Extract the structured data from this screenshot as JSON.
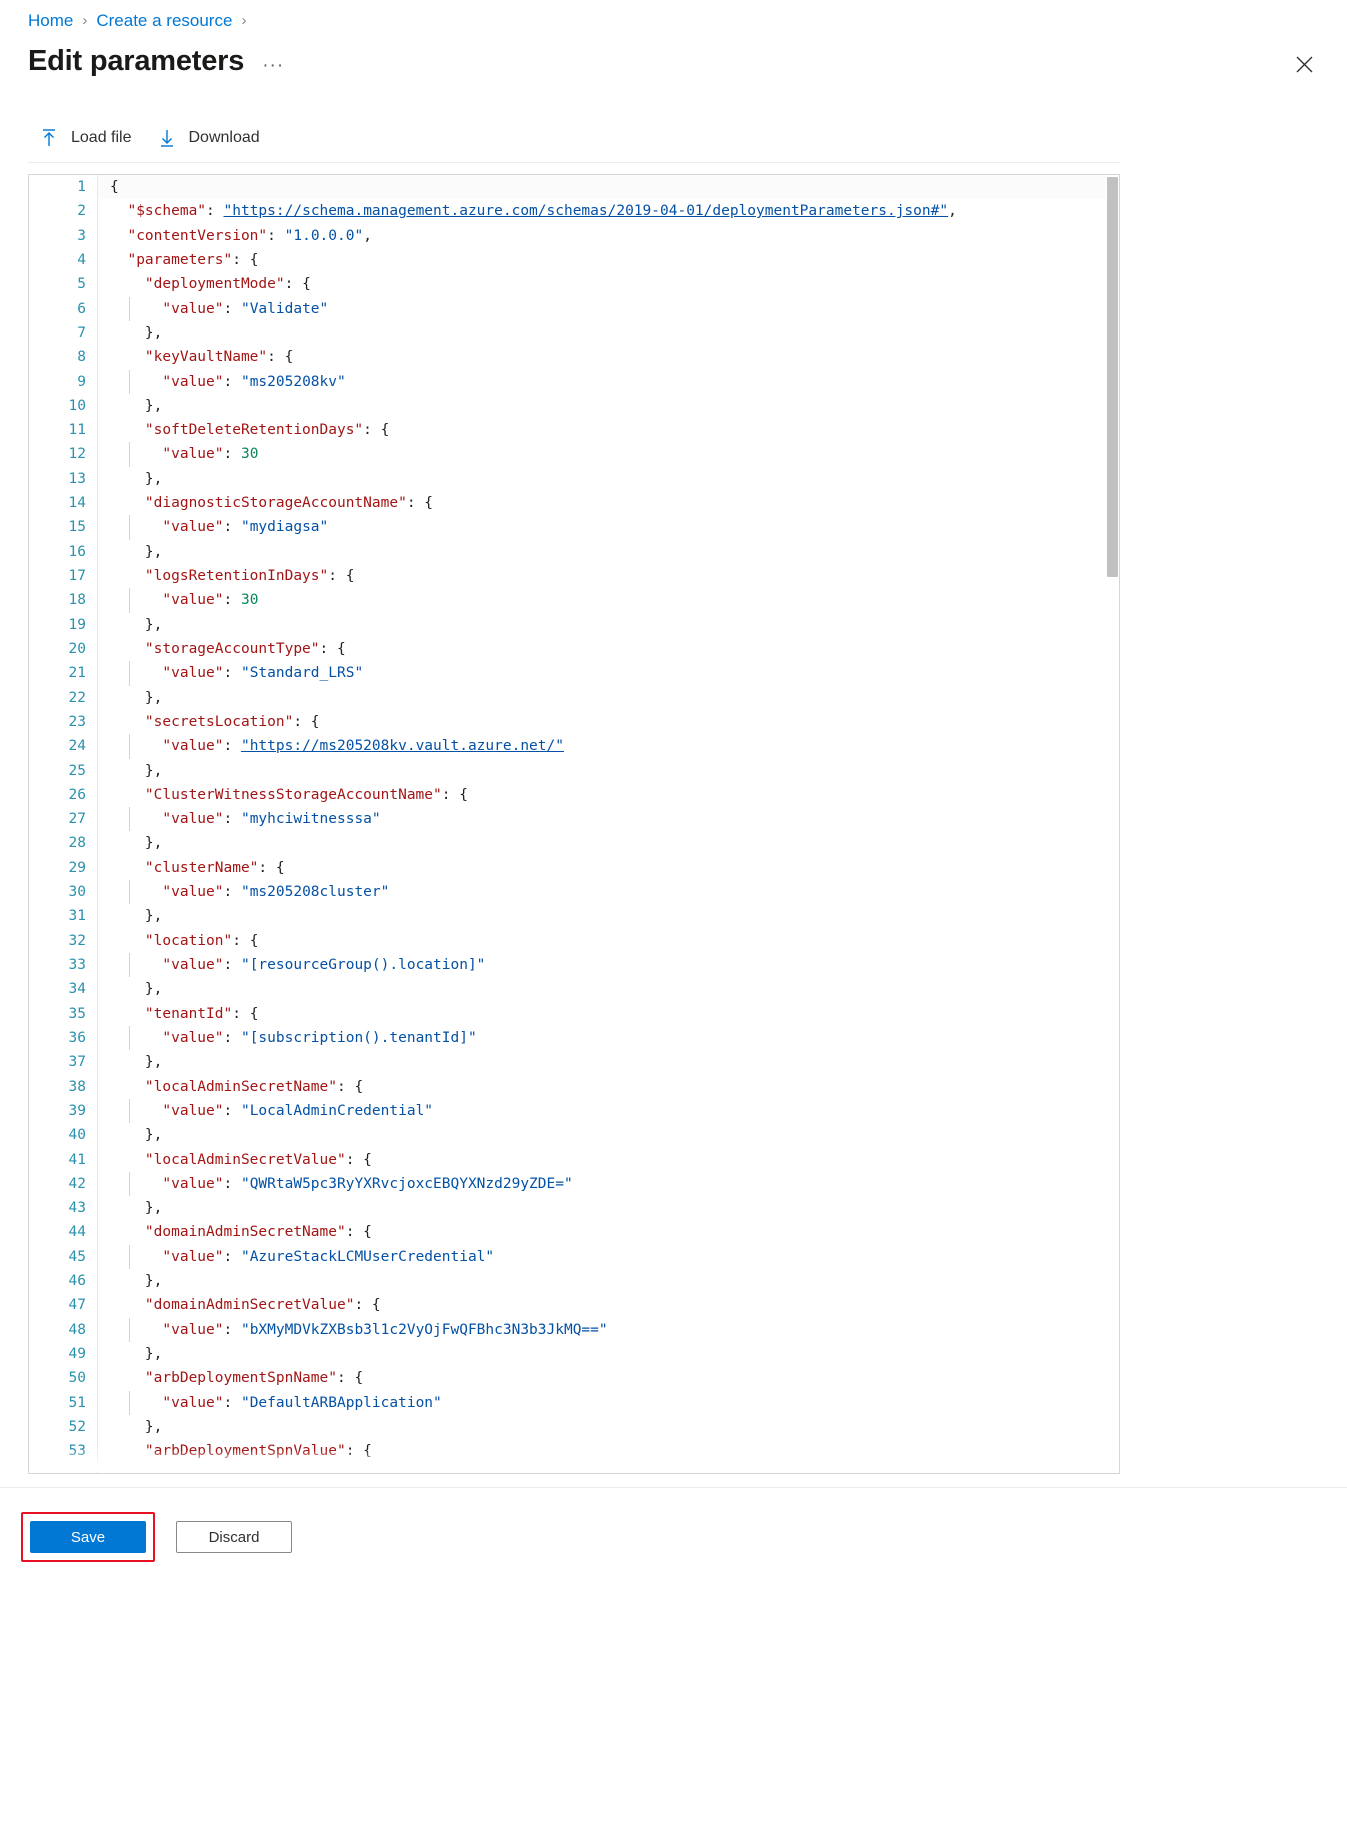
{
  "breadcrumb": {
    "items": [
      {
        "label": "Home",
        "link": true
      },
      {
        "label": "Create a resource",
        "link": true
      }
    ],
    "separator": "›"
  },
  "header": {
    "title": "Edit parameters",
    "ellipsis": "···",
    "close_label": "Close"
  },
  "toolbar": {
    "load_file_label": "Load file",
    "download_label": "Download",
    "load_file_icon": "upload-arrow-icon",
    "download_icon": "download-arrow-icon"
  },
  "editor": {
    "line_numbers": [
      1,
      2,
      3,
      4,
      5,
      6,
      7,
      8,
      9,
      10,
      11,
      12,
      13,
      14,
      15,
      16,
      17,
      18,
      19,
      20,
      21,
      22,
      23,
      24,
      25,
      26,
      27,
      28,
      29,
      30,
      31,
      32,
      33,
      34,
      35,
      36,
      37,
      38,
      39,
      40,
      41,
      42,
      43,
      44,
      45,
      46,
      47,
      48,
      49,
      50,
      51,
      52,
      53
    ],
    "colors": {
      "key": "#a31515",
      "string": "#0451a5",
      "number": "#098658",
      "punctuation": "#1f1f1f",
      "line_number": "#2b91af"
    },
    "lines": [
      {
        "n": 1,
        "indent": 0,
        "parts": [
          {
            "t": "{",
            "c": "p"
          }
        ]
      },
      {
        "n": 2,
        "indent": 1,
        "parts": [
          {
            "t": "\"$schema\"",
            "c": "k"
          },
          {
            "t": ": ",
            "c": "p"
          },
          {
            "t": "\"https://schema.management.azure.com/schemas/2019-04-01/deploymentParameters.json#\"",
            "c": "lk"
          },
          {
            "t": ",",
            "c": "p"
          }
        ]
      },
      {
        "n": 3,
        "indent": 1,
        "parts": [
          {
            "t": "\"contentVersion\"",
            "c": "k"
          },
          {
            "t": ": ",
            "c": "p"
          },
          {
            "t": "\"1.0.0.0\"",
            "c": "s"
          },
          {
            "t": ",",
            "c": "p"
          }
        ]
      },
      {
        "n": 4,
        "indent": 1,
        "parts": [
          {
            "t": "\"parameters\"",
            "c": "k"
          },
          {
            "t": ": {",
            "c": "p"
          }
        ]
      },
      {
        "n": 5,
        "indent": 2,
        "parts": [
          {
            "t": "\"deploymentMode\"",
            "c": "k"
          },
          {
            "t": ": {",
            "c": "p"
          }
        ]
      },
      {
        "n": 6,
        "indent": 3,
        "parts": [
          {
            "t": "\"value\"",
            "c": "k"
          },
          {
            "t": ": ",
            "c": "p"
          },
          {
            "t": "\"Validate\"",
            "c": "s"
          }
        ]
      },
      {
        "n": 7,
        "indent": 2,
        "parts": [
          {
            "t": "},",
            "c": "p"
          }
        ]
      },
      {
        "n": 8,
        "indent": 2,
        "parts": [
          {
            "t": "\"keyVaultName\"",
            "c": "k"
          },
          {
            "t": ": {",
            "c": "p"
          }
        ]
      },
      {
        "n": 9,
        "indent": 3,
        "parts": [
          {
            "t": "\"value\"",
            "c": "k"
          },
          {
            "t": ": ",
            "c": "p"
          },
          {
            "t": "\"ms205208kv\"",
            "c": "s"
          }
        ]
      },
      {
        "n": 10,
        "indent": 2,
        "parts": [
          {
            "t": "},",
            "c": "p"
          }
        ]
      },
      {
        "n": 11,
        "indent": 2,
        "parts": [
          {
            "t": "\"softDeleteRetentionDays\"",
            "c": "k"
          },
          {
            "t": ": {",
            "c": "p"
          }
        ]
      },
      {
        "n": 12,
        "indent": 3,
        "parts": [
          {
            "t": "\"value\"",
            "c": "k"
          },
          {
            "t": ": ",
            "c": "p"
          },
          {
            "t": "30",
            "c": "n"
          }
        ]
      },
      {
        "n": 13,
        "indent": 2,
        "parts": [
          {
            "t": "},",
            "c": "p"
          }
        ]
      },
      {
        "n": 14,
        "indent": 2,
        "parts": [
          {
            "t": "\"diagnosticStorageAccountName\"",
            "c": "k"
          },
          {
            "t": ": {",
            "c": "p"
          }
        ]
      },
      {
        "n": 15,
        "indent": 3,
        "parts": [
          {
            "t": "\"value\"",
            "c": "k"
          },
          {
            "t": ": ",
            "c": "p"
          },
          {
            "t": "\"mydiagsa\"",
            "c": "s"
          }
        ]
      },
      {
        "n": 16,
        "indent": 2,
        "parts": [
          {
            "t": "},",
            "c": "p"
          }
        ]
      },
      {
        "n": 17,
        "indent": 2,
        "parts": [
          {
            "t": "\"logsRetentionInDays\"",
            "c": "k"
          },
          {
            "t": ": {",
            "c": "p"
          }
        ]
      },
      {
        "n": 18,
        "indent": 3,
        "parts": [
          {
            "t": "\"value\"",
            "c": "k"
          },
          {
            "t": ": ",
            "c": "p"
          },
          {
            "t": "30",
            "c": "n"
          }
        ]
      },
      {
        "n": 19,
        "indent": 2,
        "parts": [
          {
            "t": "},",
            "c": "p"
          }
        ]
      },
      {
        "n": 20,
        "indent": 2,
        "parts": [
          {
            "t": "\"storageAccountType\"",
            "c": "k"
          },
          {
            "t": ": {",
            "c": "p"
          }
        ]
      },
      {
        "n": 21,
        "indent": 3,
        "parts": [
          {
            "t": "\"value\"",
            "c": "k"
          },
          {
            "t": ": ",
            "c": "p"
          },
          {
            "t": "\"Standard_LRS\"",
            "c": "s"
          }
        ]
      },
      {
        "n": 22,
        "indent": 2,
        "parts": [
          {
            "t": "},",
            "c": "p"
          }
        ]
      },
      {
        "n": 23,
        "indent": 2,
        "parts": [
          {
            "t": "\"secretsLocation\"",
            "c": "k"
          },
          {
            "t": ": {",
            "c": "p"
          }
        ]
      },
      {
        "n": 24,
        "indent": 3,
        "parts": [
          {
            "t": "\"value\"",
            "c": "k"
          },
          {
            "t": ": ",
            "c": "p"
          },
          {
            "t": "\"https://ms205208kv.vault.azure.net/\"",
            "c": "lk"
          }
        ]
      },
      {
        "n": 25,
        "indent": 2,
        "parts": [
          {
            "t": "},",
            "c": "p"
          }
        ]
      },
      {
        "n": 26,
        "indent": 2,
        "parts": [
          {
            "t": "\"ClusterWitnessStorageAccountName\"",
            "c": "k"
          },
          {
            "t": ": {",
            "c": "p"
          }
        ]
      },
      {
        "n": 27,
        "indent": 3,
        "parts": [
          {
            "t": "\"value\"",
            "c": "k"
          },
          {
            "t": ": ",
            "c": "p"
          },
          {
            "t": "\"myhciwitnesssa\"",
            "c": "s"
          }
        ]
      },
      {
        "n": 28,
        "indent": 2,
        "parts": [
          {
            "t": "},",
            "c": "p"
          }
        ]
      },
      {
        "n": 29,
        "indent": 2,
        "parts": [
          {
            "t": "\"clusterName\"",
            "c": "k"
          },
          {
            "t": ": {",
            "c": "p"
          }
        ]
      },
      {
        "n": 30,
        "indent": 3,
        "parts": [
          {
            "t": "\"value\"",
            "c": "k"
          },
          {
            "t": ": ",
            "c": "p"
          },
          {
            "t": "\"ms205208cluster\"",
            "c": "s"
          }
        ]
      },
      {
        "n": 31,
        "indent": 2,
        "parts": [
          {
            "t": "},",
            "c": "p"
          }
        ]
      },
      {
        "n": 32,
        "indent": 2,
        "parts": [
          {
            "t": "\"location\"",
            "c": "k"
          },
          {
            "t": ": {",
            "c": "p"
          }
        ]
      },
      {
        "n": 33,
        "indent": 3,
        "parts": [
          {
            "t": "\"value\"",
            "c": "k"
          },
          {
            "t": ": ",
            "c": "p"
          },
          {
            "t": "\"[resourceGroup().location]\"",
            "c": "s"
          }
        ]
      },
      {
        "n": 34,
        "indent": 2,
        "parts": [
          {
            "t": "},",
            "c": "p"
          }
        ]
      },
      {
        "n": 35,
        "indent": 2,
        "parts": [
          {
            "t": "\"tenantId\"",
            "c": "k"
          },
          {
            "t": ": {",
            "c": "p"
          }
        ]
      },
      {
        "n": 36,
        "indent": 3,
        "parts": [
          {
            "t": "\"value\"",
            "c": "k"
          },
          {
            "t": ": ",
            "c": "p"
          },
          {
            "t": "\"[subscription().tenantId]\"",
            "c": "s"
          }
        ]
      },
      {
        "n": 37,
        "indent": 2,
        "parts": [
          {
            "t": "},",
            "c": "p"
          }
        ]
      },
      {
        "n": 38,
        "indent": 2,
        "parts": [
          {
            "t": "\"localAdminSecretName\"",
            "c": "k"
          },
          {
            "t": ": {",
            "c": "p"
          }
        ]
      },
      {
        "n": 39,
        "indent": 3,
        "parts": [
          {
            "t": "\"value\"",
            "c": "k"
          },
          {
            "t": ": ",
            "c": "p"
          },
          {
            "t": "\"LocalAdminCredential\"",
            "c": "s"
          }
        ]
      },
      {
        "n": 40,
        "indent": 2,
        "parts": [
          {
            "t": "},",
            "c": "p"
          }
        ]
      },
      {
        "n": 41,
        "indent": 2,
        "parts": [
          {
            "t": "\"localAdminSecretValue\"",
            "c": "k"
          },
          {
            "t": ": {",
            "c": "p"
          }
        ]
      },
      {
        "n": 42,
        "indent": 3,
        "parts": [
          {
            "t": "\"value\"",
            "c": "k"
          },
          {
            "t": ": ",
            "c": "p"
          },
          {
            "t": "\"QWRtaW5pc3RyYXRvcjoxcEBQYXNzd29yZDE=\"",
            "c": "s"
          }
        ]
      },
      {
        "n": 43,
        "indent": 2,
        "parts": [
          {
            "t": "},",
            "c": "p"
          }
        ]
      },
      {
        "n": 44,
        "indent": 2,
        "parts": [
          {
            "t": "\"domainAdminSecretName\"",
            "c": "k"
          },
          {
            "t": ": {",
            "c": "p"
          }
        ]
      },
      {
        "n": 45,
        "indent": 3,
        "parts": [
          {
            "t": "\"value\"",
            "c": "k"
          },
          {
            "t": ": ",
            "c": "p"
          },
          {
            "t": "\"AzureStackLCMUserCredential\"",
            "c": "s"
          }
        ]
      },
      {
        "n": 46,
        "indent": 2,
        "parts": [
          {
            "t": "},",
            "c": "p"
          }
        ]
      },
      {
        "n": 47,
        "indent": 2,
        "parts": [
          {
            "t": "\"domainAdminSecretValue\"",
            "c": "k"
          },
          {
            "t": ": {",
            "c": "p"
          }
        ]
      },
      {
        "n": 48,
        "indent": 3,
        "parts": [
          {
            "t": "\"value\"",
            "c": "k"
          },
          {
            "t": ": ",
            "c": "p"
          },
          {
            "t": "\"bXMyMDVkZXBsb3l1c2VyOjFwQFBhc3N3b3JkMQ==\"",
            "c": "s"
          }
        ]
      },
      {
        "n": 49,
        "indent": 2,
        "parts": [
          {
            "t": "},",
            "c": "p"
          }
        ]
      },
      {
        "n": 50,
        "indent": 2,
        "parts": [
          {
            "t": "\"arbDeploymentSpnName\"",
            "c": "k"
          },
          {
            "t": ": {",
            "c": "p"
          }
        ]
      },
      {
        "n": 51,
        "indent": 3,
        "parts": [
          {
            "t": "\"value\"",
            "c": "k"
          },
          {
            "t": ": ",
            "c": "p"
          },
          {
            "t": "\"DefaultARBApplication\"",
            "c": "s"
          }
        ]
      },
      {
        "n": 52,
        "indent": 2,
        "parts": [
          {
            "t": "},",
            "c": "p"
          }
        ]
      },
      {
        "n": 53,
        "indent": 2,
        "parts": [
          {
            "t": "\"arbDeploymentSpnValue\"",
            "c": "k"
          },
          {
            "t": ": {",
            "c": "p"
          }
        ]
      }
    ]
  },
  "footer": {
    "save_label": "Save",
    "discard_label": "Discard",
    "save_highlight_color": "#e81123",
    "primary_color": "#0078d4"
  }
}
